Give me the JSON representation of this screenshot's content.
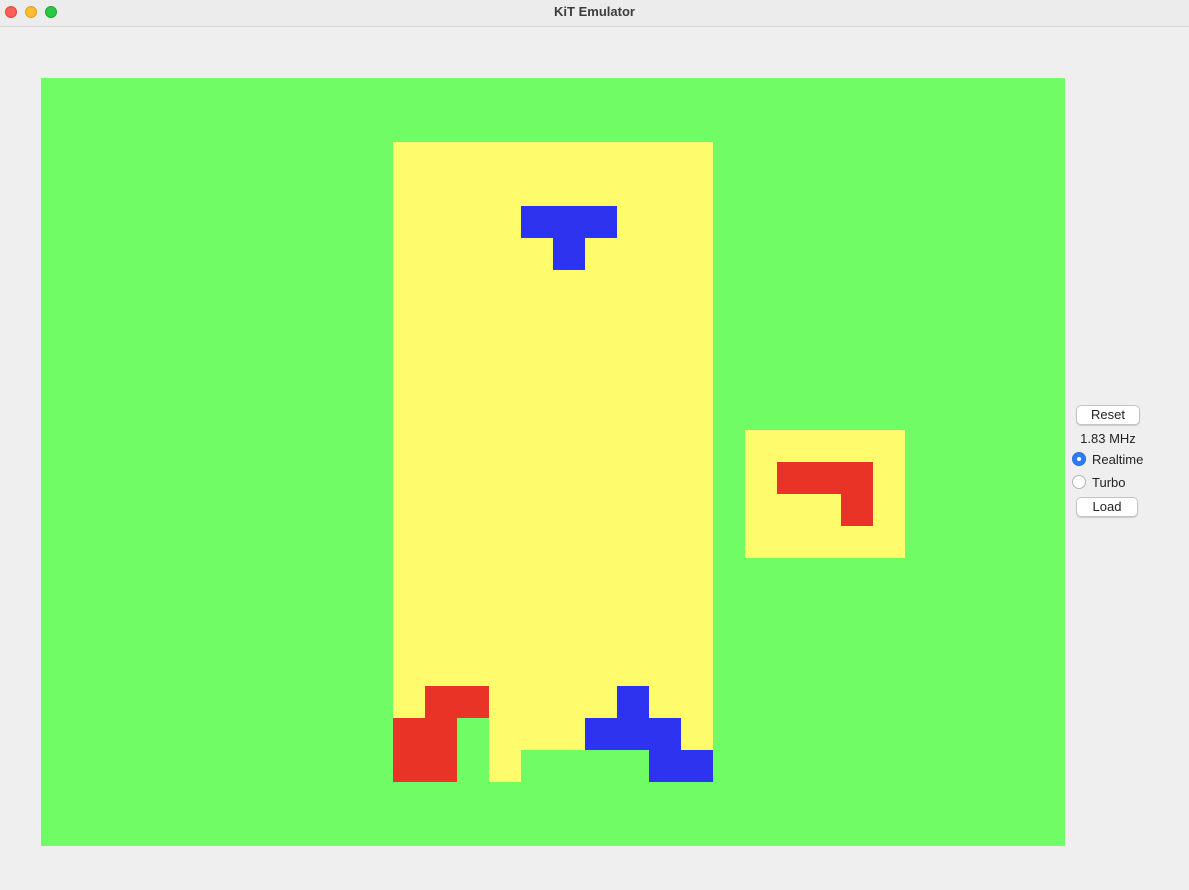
{
  "window": {
    "title": "KiT Emulator"
  },
  "game": {
    "colors": {
      "background": "#6ffc64",
      "well": "#fefb6c",
      "blue": "#2d33ee",
      "red": "#ea3327",
      "green": "#6ffc64"
    },
    "well_columns": 10,
    "well_rows": 20,
    "falling_piece": {
      "shape": "T",
      "color": "blue"
    },
    "next_piece": {
      "shape": "J",
      "color": "red"
    }
  },
  "controls": {
    "reset_label": "Reset",
    "frequency": "1.83 MHz",
    "mode_options": [
      {
        "label": "Realtime",
        "selected": true
      },
      {
        "label": "Turbo",
        "selected": false
      }
    ],
    "load_label": "Load"
  }
}
